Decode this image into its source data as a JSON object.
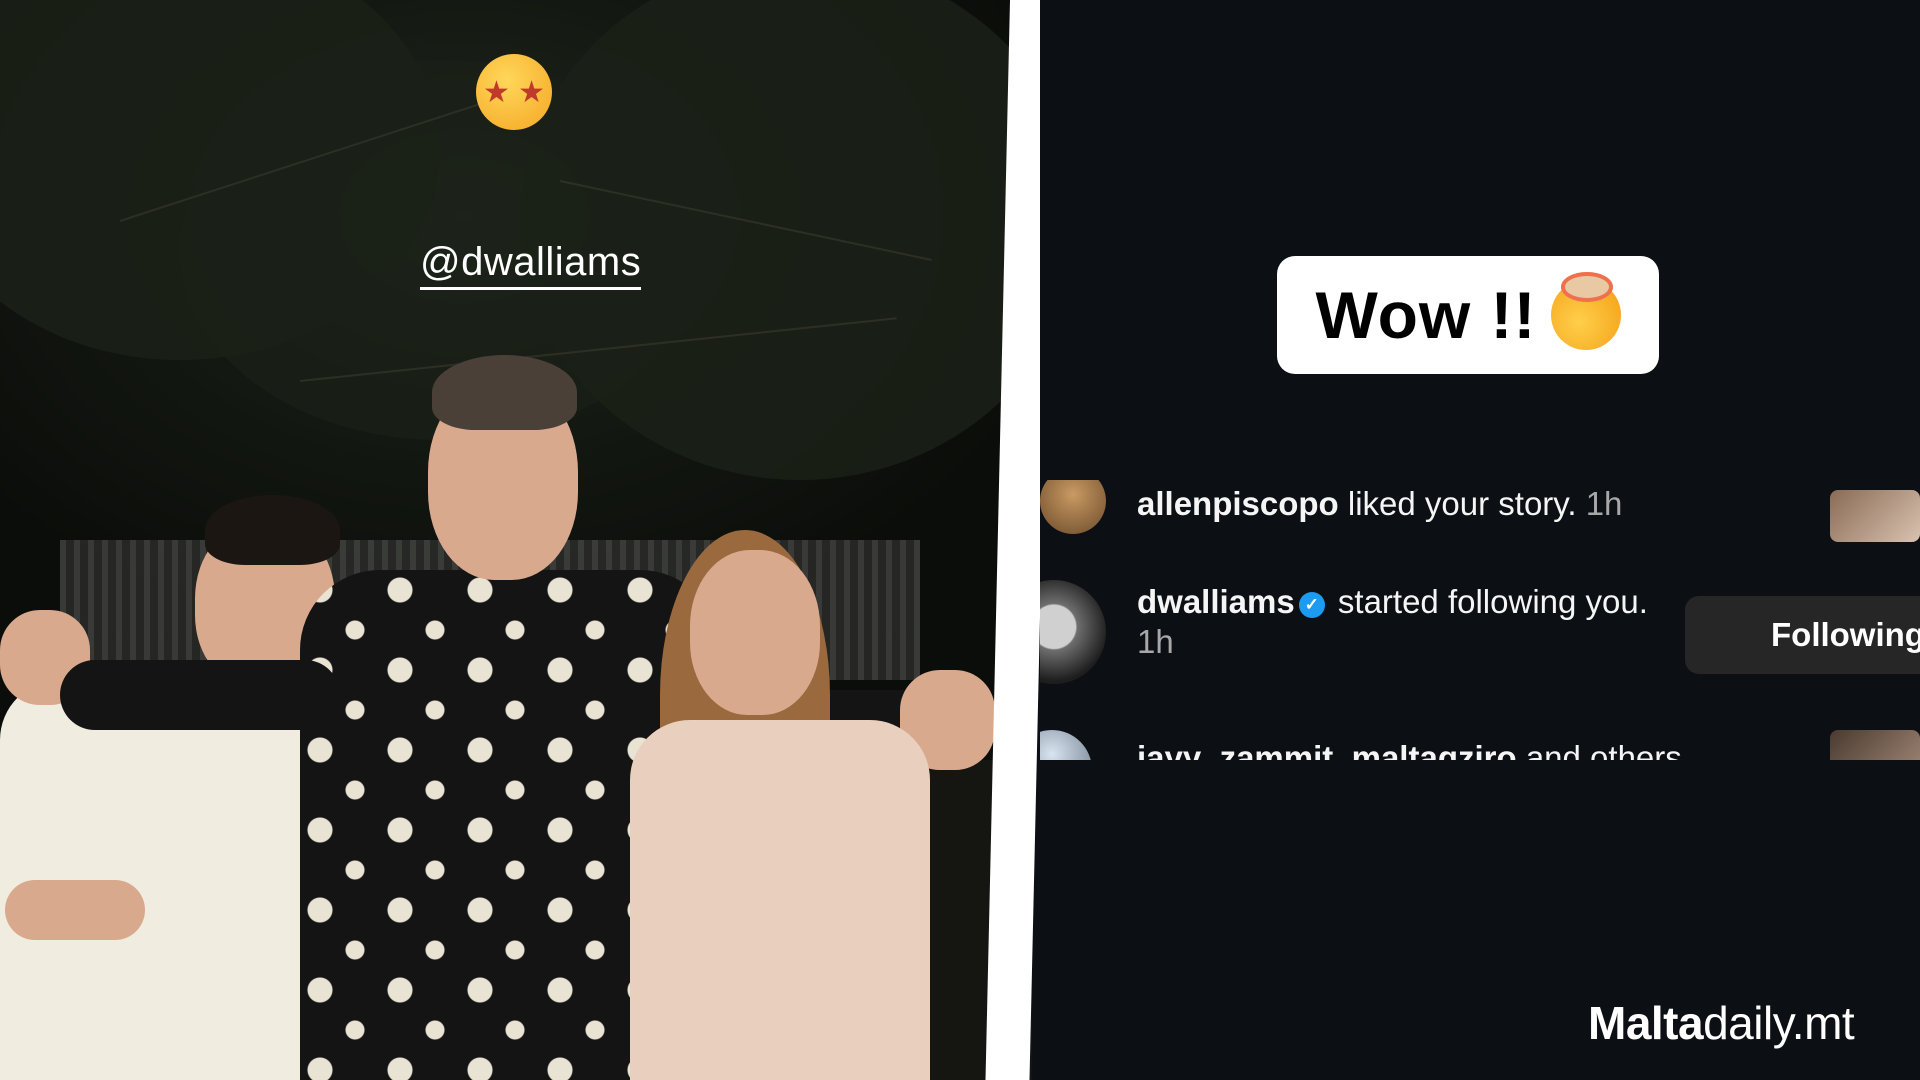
{
  "story": {
    "mention": "@dwalliams",
    "sticker_icon": "star-struck-emoji-icon"
  },
  "reply": {
    "text": "Wow !!",
    "emoji_icon": "exploding-head-emoji-icon"
  },
  "notifications": [
    {
      "username": "allenpiscopo",
      "text": " liked your story.",
      "time": " 1h",
      "verified": false
    },
    {
      "username": "dwalliams",
      "text": " started following you.",
      "time": " 1h",
      "verified": true,
      "button_label": "Following"
    },
    {
      "username": "jayy_zammit, maltagziro",
      "text": " and others"
    }
  ],
  "branding": {
    "name_bold": "Malta",
    "name_rest": "daily.mt"
  },
  "colors": {
    "panel_bg": "#0c1014",
    "verified_blue": "#1d9bf0",
    "button_bg": "#262626"
  }
}
